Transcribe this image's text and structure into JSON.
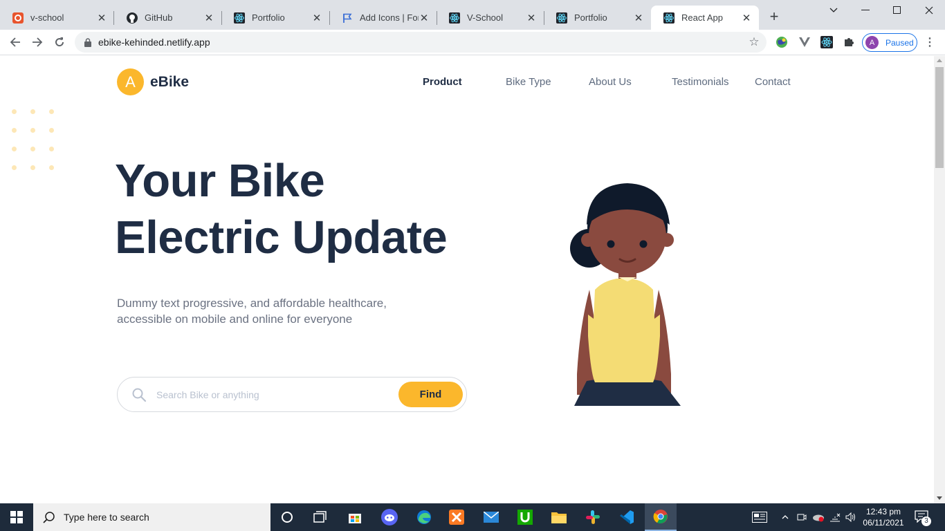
{
  "browser": {
    "tabs": [
      {
        "title": "v-school",
        "icon": "vschool-icon",
        "active": false
      },
      {
        "title": "GitHub",
        "icon": "github-icon",
        "active": false
      },
      {
        "title": "Portfolio",
        "icon": "react-icon",
        "active": false
      },
      {
        "title": "Add Icons | Font",
        "icon": "flag-icon",
        "active": false
      },
      {
        "title": "V-School",
        "icon": "react-icon",
        "active": false
      },
      {
        "title": "Portfolio",
        "icon": "react-icon",
        "active": false
      },
      {
        "title": "React App",
        "icon": "react-icon",
        "active": true
      }
    ],
    "new_tab_label": "+",
    "url": "ebike-kehinded.netlify.app",
    "profile": {
      "initial": "A",
      "status": "Paused"
    }
  },
  "site": {
    "logo_mark": "A",
    "logo_text": "eBike",
    "nav": [
      "Product",
      "Bike Type",
      "About Us",
      "Testimonials",
      "Contact"
    ],
    "active_nav": "Product",
    "hero": {
      "title_line1": "Your Bike",
      "title_line2": "Electric Update",
      "subtitle": "Dummy text progressive, and affordable healthcare, accessible on mobile and online for everyone"
    },
    "search": {
      "placeholder": "Search Bike or anything",
      "button_label": "Find"
    },
    "colors": {
      "accent": "#fbb72c",
      "heading": "#1f2d44",
      "body_text": "#6b7282"
    }
  },
  "taskbar": {
    "search_placeholder": "Type here to search",
    "time": "12:43 pm",
    "date": "06/11/2021",
    "notification_count": "3"
  }
}
